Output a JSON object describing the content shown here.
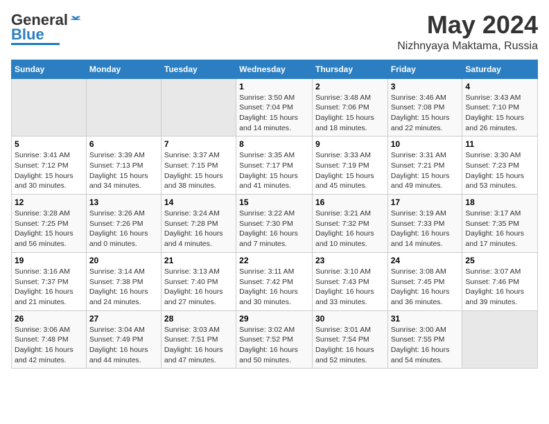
{
  "header": {
    "logo_general": "General",
    "logo_blue": "Blue",
    "title": "May 2024",
    "location": "Nizhnyaya Maktama, Russia"
  },
  "weekdays": [
    "Sunday",
    "Monday",
    "Tuesday",
    "Wednesday",
    "Thursday",
    "Friday",
    "Saturday"
  ],
  "weeks": [
    [
      {
        "day": "",
        "info": ""
      },
      {
        "day": "",
        "info": ""
      },
      {
        "day": "",
        "info": ""
      },
      {
        "day": "1",
        "info": "Sunrise: 3:50 AM\nSunset: 7:04 PM\nDaylight: 15 hours\nand 14 minutes."
      },
      {
        "day": "2",
        "info": "Sunrise: 3:48 AM\nSunset: 7:06 PM\nDaylight: 15 hours\nand 18 minutes."
      },
      {
        "day": "3",
        "info": "Sunrise: 3:46 AM\nSunset: 7:08 PM\nDaylight: 15 hours\nand 22 minutes."
      },
      {
        "day": "4",
        "info": "Sunrise: 3:43 AM\nSunset: 7:10 PM\nDaylight: 15 hours\nand 26 minutes."
      }
    ],
    [
      {
        "day": "5",
        "info": "Sunrise: 3:41 AM\nSunset: 7:12 PM\nDaylight: 15 hours\nand 30 minutes."
      },
      {
        "day": "6",
        "info": "Sunrise: 3:39 AM\nSunset: 7:13 PM\nDaylight: 15 hours\nand 34 minutes."
      },
      {
        "day": "7",
        "info": "Sunrise: 3:37 AM\nSunset: 7:15 PM\nDaylight: 15 hours\nand 38 minutes."
      },
      {
        "day": "8",
        "info": "Sunrise: 3:35 AM\nSunset: 7:17 PM\nDaylight: 15 hours\nand 41 minutes."
      },
      {
        "day": "9",
        "info": "Sunrise: 3:33 AM\nSunset: 7:19 PM\nDaylight: 15 hours\nand 45 minutes."
      },
      {
        "day": "10",
        "info": "Sunrise: 3:31 AM\nSunset: 7:21 PM\nDaylight: 15 hours\nand 49 minutes."
      },
      {
        "day": "11",
        "info": "Sunrise: 3:30 AM\nSunset: 7:23 PM\nDaylight: 15 hours\nand 53 minutes."
      }
    ],
    [
      {
        "day": "12",
        "info": "Sunrise: 3:28 AM\nSunset: 7:25 PM\nDaylight: 15 hours\nand 56 minutes."
      },
      {
        "day": "13",
        "info": "Sunrise: 3:26 AM\nSunset: 7:26 PM\nDaylight: 16 hours\nand 0 minutes."
      },
      {
        "day": "14",
        "info": "Sunrise: 3:24 AM\nSunset: 7:28 PM\nDaylight: 16 hours\nand 4 minutes."
      },
      {
        "day": "15",
        "info": "Sunrise: 3:22 AM\nSunset: 7:30 PM\nDaylight: 16 hours\nand 7 minutes."
      },
      {
        "day": "16",
        "info": "Sunrise: 3:21 AM\nSunset: 7:32 PM\nDaylight: 16 hours\nand 10 minutes."
      },
      {
        "day": "17",
        "info": "Sunrise: 3:19 AM\nSunset: 7:33 PM\nDaylight: 16 hours\nand 14 minutes."
      },
      {
        "day": "18",
        "info": "Sunrise: 3:17 AM\nSunset: 7:35 PM\nDaylight: 16 hours\nand 17 minutes."
      }
    ],
    [
      {
        "day": "19",
        "info": "Sunrise: 3:16 AM\nSunset: 7:37 PM\nDaylight: 16 hours\nand 21 minutes."
      },
      {
        "day": "20",
        "info": "Sunrise: 3:14 AM\nSunset: 7:38 PM\nDaylight: 16 hours\nand 24 minutes."
      },
      {
        "day": "21",
        "info": "Sunrise: 3:13 AM\nSunset: 7:40 PM\nDaylight: 16 hours\nand 27 minutes."
      },
      {
        "day": "22",
        "info": "Sunrise: 3:11 AM\nSunset: 7:42 PM\nDaylight: 16 hours\nand 30 minutes."
      },
      {
        "day": "23",
        "info": "Sunrise: 3:10 AM\nSunset: 7:43 PM\nDaylight: 16 hours\nand 33 minutes."
      },
      {
        "day": "24",
        "info": "Sunrise: 3:08 AM\nSunset: 7:45 PM\nDaylight: 16 hours\nand 36 minutes."
      },
      {
        "day": "25",
        "info": "Sunrise: 3:07 AM\nSunset: 7:46 PM\nDaylight: 16 hours\nand 39 minutes."
      }
    ],
    [
      {
        "day": "26",
        "info": "Sunrise: 3:06 AM\nSunset: 7:48 PM\nDaylight: 16 hours\nand 42 minutes."
      },
      {
        "day": "27",
        "info": "Sunrise: 3:04 AM\nSunset: 7:49 PM\nDaylight: 16 hours\nand 44 minutes."
      },
      {
        "day": "28",
        "info": "Sunrise: 3:03 AM\nSunset: 7:51 PM\nDaylight: 16 hours\nand 47 minutes."
      },
      {
        "day": "29",
        "info": "Sunrise: 3:02 AM\nSunset: 7:52 PM\nDaylight: 16 hours\nand 50 minutes."
      },
      {
        "day": "30",
        "info": "Sunrise: 3:01 AM\nSunset: 7:54 PM\nDaylight: 16 hours\nand 52 minutes."
      },
      {
        "day": "31",
        "info": "Sunrise: 3:00 AM\nSunset: 7:55 PM\nDaylight: 16 hours\nand 54 minutes."
      },
      {
        "day": "",
        "info": ""
      }
    ]
  ]
}
